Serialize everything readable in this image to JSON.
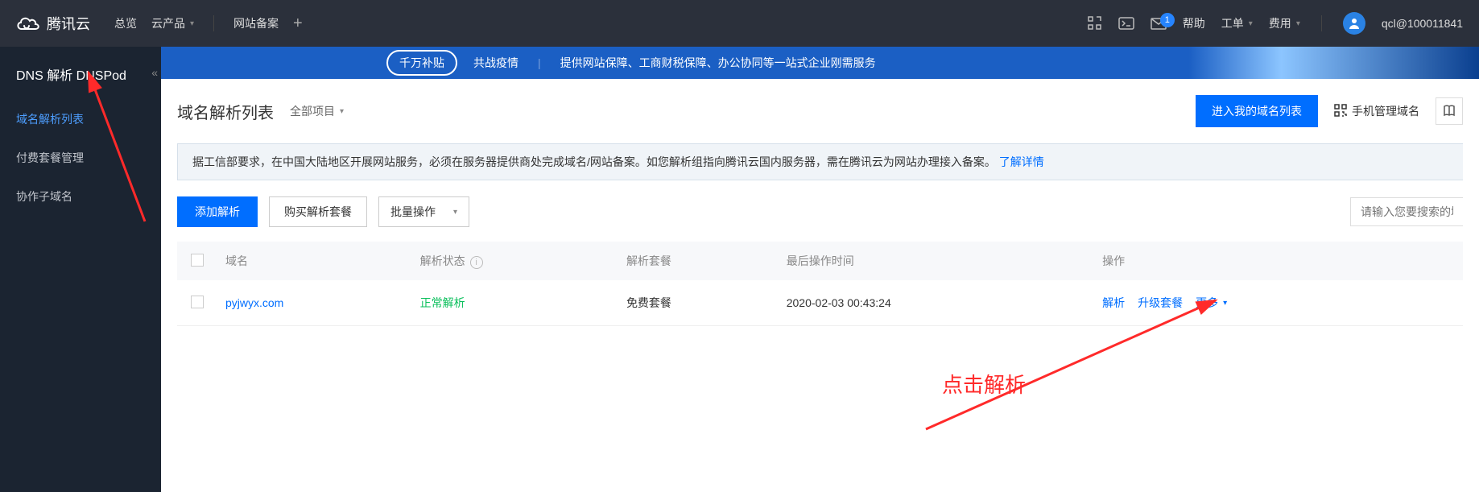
{
  "topbar": {
    "brand": "腾讯云",
    "links": {
      "overview": "总览",
      "products": "云产品",
      "beian": "网站备案"
    },
    "right": {
      "mail_badge": "1",
      "help": "帮助",
      "work_order": "工单",
      "cost": "费用",
      "account": "qcl@100011841"
    }
  },
  "sidebar": {
    "title": "DNS 解析 DNSPod",
    "items": [
      {
        "label": "域名解析列表",
        "active": true
      },
      {
        "label": "付费套餐管理",
        "active": false
      },
      {
        "label": "协作子域名",
        "active": false
      }
    ]
  },
  "banner": {
    "badge": "千万补贴",
    "slogan1": "共战疫情",
    "slogan2": "提供网站保障、工商财税保障、办公协同等一站式企业刚需服务"
  },
  "page": {
    "title": "域名解析列表",
    "project": "全部项目",
    "enter_domain_list": "进入我的域名列表",
    "mobile_manage": "手机管理域名"
  },
  "notice": {
    "text": "据工信部要求，在中国大陆地区开展网站服务，必须在服务器提供商处完成域名/网站备案。如您解析组指向腾讯云国内服务器，需在腾讯云为网站办理接入备案。",
    "link": "了解详情"
  },
  "actions": {
    "add": "添加解析",
    "buy": "购买解析套餐",
    "batch": "批量操作",
    "search_placeholder": "请输入您要搜索的域名"
  },
  "table": {
    "headers": {
      "domain": "域名",
      "status": "解析状态",
      "plan": "解析套餐",
      "last_op": "最后操作时间",
      "op": "操作"
    },
    "rows": [
      {
        "domain": "pyjwyx.com",
        "status": "正常解析",
        "plan": "免费套餐",
        "last_op": "2020-02-03 00:43:24",
        "ops": {
          "resolve": "解析",
          "upgrade": "升级套餐",
          "more": "更多"
        }
      }
    ]
  },
  "annotation": {
    "click_resolve": "点击解析"
  }
}
